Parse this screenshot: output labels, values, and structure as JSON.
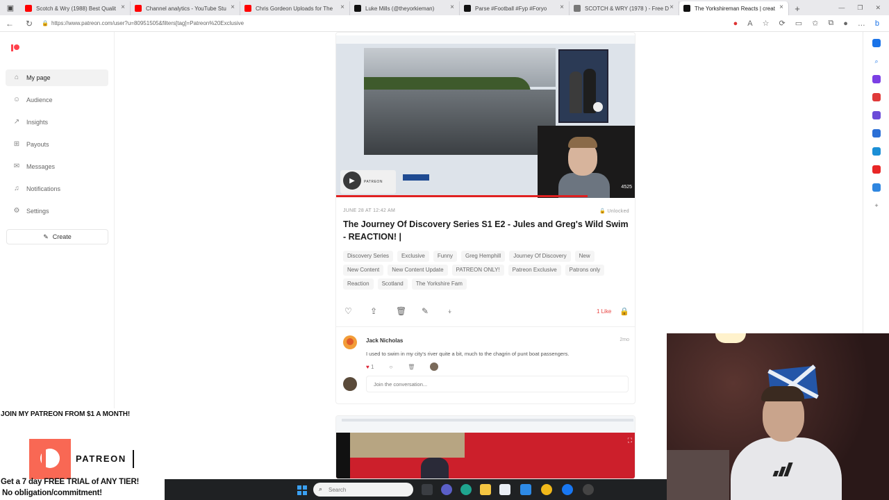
{
  "browser": {
    "tabs": [
      {
        "label": "Scotch & Wry (1988) Best Qualit",
        "color": "#ff0000"
      },
      {
        "label": "Channel analytics - YouTube Stu",
        "color": "#ff0000"
      },
      {
        "label": "Chris Gordeon Uploads for The",
        "color": "#ff0000"
      },
      {
        "label": "Luke Mills (@theyorkieman)",
        "color": "#111111"
      },
      {
        "label": "Parse #Football #Fyp #Foryo",
        "color": "#111111"
      },
      {
        "label": "SCOTCH & WRY (1978 ) - Free D",
        "color": "#777777"
      },
      {
        "label": "The Yorkshireman Reacts | creat",
        "color": "#111111",
        "active": true
      }
    ],
    "url": "https://www.patreon.com/user?u=80951505&filters[tag]=Patreon%20Exclusive"
  },
  "sidebar": {
    "items": [
      {
        "label": "My page",
        "icon": "home-icon",
        "glyph": "⌂",
        "active": true
      },
      {
        "label": "Audience",
        "icon": "people-icon",
        "glyph": "☺"
      },
      {
        "label": "Insights",
        "icon": "chart-icon",
        "glyph": "↗"
      },
      {
        "label": "Payouts",
        "icon": "payouts-icon",
        "glyph": "⊞"
      },
      {
        "label": "Messages",
        "icon": "envelope-icon",
        "glyph": "✉"
      },
      {
        "label": "Notifications",
        "icon": "bell-icon",
        "glyph": "♫"
      },
      {
        "label": "Settings",
        "icon": "gear-icon",
        "glyph": "⚙"
      }
    ],
    "create_label": "Create"
  },
  "post": {
    "date": "JUNE 28 AT 12:42 AM",
    "lock_status": "Unlocked",
    "title": "The Journey Of Discovery Series S1 E2 - Jules and Greg's Wild Swim - REACTION! |",
    "tags": [
      "Discovery Series",
      "Exclusive",
      "Funny",
      "Greg Hemphill",
      "Journey Of Discovery",
      "New",
      "New Content",
      "New Content Update",
      "PATREON ONLY!",
      "Patreon Exclusive",
      "Patrons only",
      "Reaction",
      "Scotland",
      "The Yorkshire Fam"
    ],
    "likes": "1 Like",
    "video_counter": "4525",
    "mini_label": "PATREON",
    "comment": {
      "author": "Jack Nicholas",
      "time": "2mo",
      "text": "I used to swim in my city's river quite a bit, much to the chagrin of punt boat passengers.",
      "heart_count": "1"
    },
    "join_placeholder": "Join the conversation..."
  },
  "overlay": {
    "line1": "JOIN MY PATREON FROM $1 A MONTH!",
    "wordmark": "PATREON",
    "line2": "Get a 7 day FREE TRIAL of ANY TIER!",
    "line3": "No obligation/commitment!"
  },
  "taskbar": {
    "search_placeholder": "Search"
  }
}
